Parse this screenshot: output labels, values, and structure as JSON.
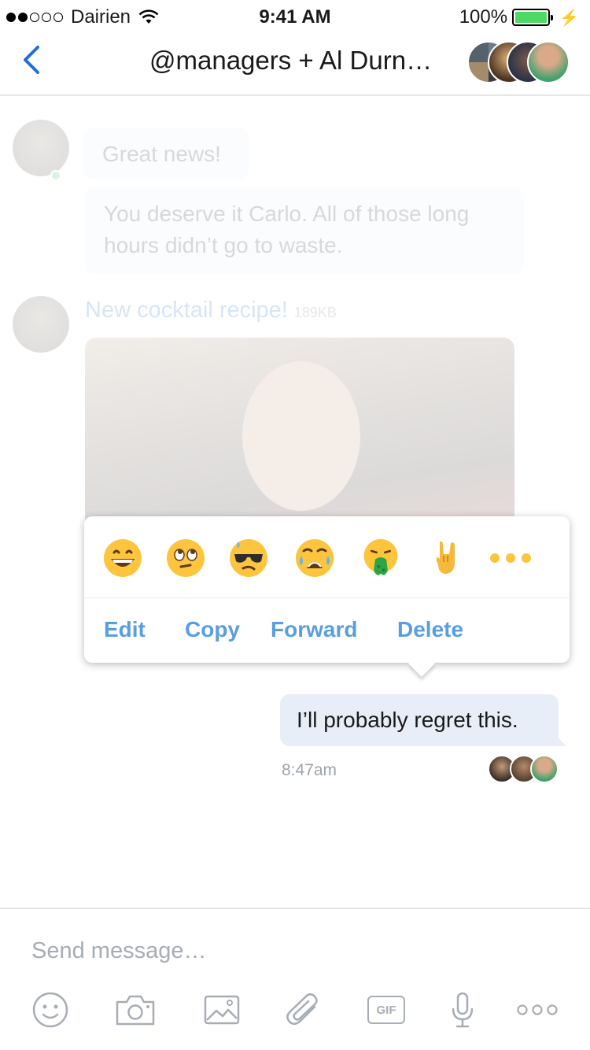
{
  "status_bar": {
    "carrier": "Dairien",
    "time": "9:41 AM",
    "battery": "100%"
  },
  "nav": {
    "title": "@managers + Al Durn…"
  },
  "messages": [
    {
      "text": "Great news!"
    },
    {
      "text": "You deserve it Carlo. All of those long hours didn’t go to waste."
    }
  ],
  "file_message": {
    "title": "New cocktail recipe!",
    "size": "189KB"
  },
  "reaction_popup": {
    "emojis": [
      "grinning-face",
      "eye-roll-face",
      "hot-sunglasses-face",
      "crying-face",
      "vomit-face",
      "rock-on-hand",
      "more"
    ],
    "actions": {
      "edit": "Edit",
      "copy": "Copy",
      "forward": "Forward",
      "delete": "Delete"
    }
  },
  "outgoing": {
    "text": "I’ll probably regret this.",
    "time": "8:47am"
  },
  "composer": {
    "placeholder": "Send message…",
    "gif_label": "GIF"
  },
  "colors": {
    "accent": "#1d6fd6",
    "action_text": "#5a9ee0",
    "emoji_yellow": "#fdc43e",
    "online": "#3bbf4a"
  }
}
